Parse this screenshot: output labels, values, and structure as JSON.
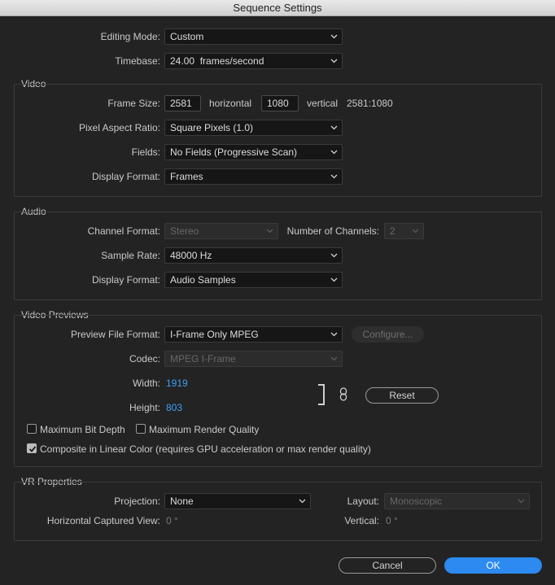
{
  "window": {
    "title": "Sequence Settings"
  },
  "general": {
    "editing_mode_label": "Editing Mode:",
    "editing_mode_value": "Custom",
    "timebase_label": "Timebase:",
    "timebase_value": "24.00  frames/second"
  },
  "video": {
    "title": "Video",
    "frame_size_label": "Frame Size:",
    "width_value": "2581",
    "horizontal_label": "horizontal",
    "height_value": "1080",
    "vertical_label": "vertical",
    "aspect_readout": "2581:1080",
    "pixel_aspect_label": "Pixel Aspect Ratio:",
    "pixel_aspect_value": "Square Pixels (1.0)",
    "fields_label": "Fields:",
    "fields_value": "No Fields (Progressive Scan)",
    "display_format_label": "Display Format:",
    "display_format_value": "Frames"
  },
  "audio": {
    "title": "Audio",
    "channel_format_label": "Channel Format:",
    "channel_format_value": "Stereo",
    "num_channels_label": "Number of Channels:",
    "num_channels_value": "2",
    "sample_rate_label": "Sample Rate:",
    "sample_rate_value": "48000 Hz",
    "display_format_label": "Display Format:",
    "display_format_value": "Audio Samples"
  },
  "previews": {
    "title": "Video Previews",
    "file_format_label": "Preview File Format:",
    "file_format_value": "I-Frame Only MPEG",
    "configure_label": "Configure...",
    "codec_label": "Codec:",
    "codec_value": "MPEG I-Frame",
    "width_label": "Width:",
    "width_value": "1919",
    "height_label": "Height:",
    "height_value": "803",
    "reset_label": "Reset",
    "max_bit_depth_label": "Maximum Bit Depth",
    "max_bit_depth_checked": false,
    "max_render_quality_label": "Maximum Render Quality",
    "max_render_quality_checked": false,
    "composite_linear_label": "Composite in Linear Color (requires GPU acceleration or max render quality)",
    "composite_linear_checked": true
  },
  "vr": {
    "title": "VR Properties",
    "projection_label": "Projection:",
    "projection_value": "None",
    "layout_label": "Layout:",
    "layout_value": "Monoscopic",
    "h_captured_label": "Horizontal Captured View:",
    "h_captured_value": "0 °",
    "vertical_label": "Vertical:",
    "vertical_value": "0 °"
  },
  "footer": {
    "cancel_label": "Cancel",
    "ok_label": "OK"
  },
  "colors": {
    "background": "#232323",
    "accent": "#2c8af0",
    "link_value": "#3e9ff5"
  }
}
